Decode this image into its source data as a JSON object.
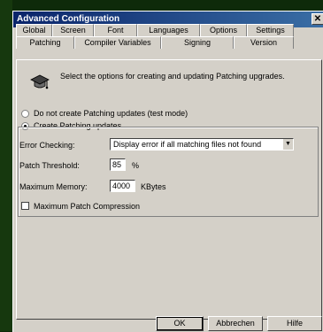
{
  "window": {
    "title": "Advanced Configuration",
    "close_glyph": "✕"
  },
  "tabs_row1": [
    "Global",
    "Screen",
    "Font",
    "Languages",
    "Options",
    "Settings"
  ],
  "tabs_row2": [
    "Patching",
    "Compiler Variables",
    "Signing",
    "Version"
  ],
  "active_tab": "Patching",
  "intro_text": "Select the options for creating and updating Patching upgrades.",
  "options": {
    "no_create": "Do not create Patching updates (test mode)",
    "create": "Create Patching updates",
    "selected": "create"
  },
  "error_checking": {
    "label": "Error Checking:",
    "value": "Display error if all matching files not found"
  },
  "patch_threshold": {
    "label": "Patch Threshold:",
    "value": "85",
    "unit": "%"
  },
  "max_memory": {
    "label": "Maximum Memory:",
    "value": "4000",
    "unit": "KBytes"
  },
  "max_compression": {
    "label": "Maximum Patch Compression",
    "checked": false
  },
  "buttons": {
    "ok": "OK",
    "cancel": "Abbrechen",
    "help": "Hilfe"
  },
  "icons": {
    "wizard": "graduation-cap-icon"
  }
}
